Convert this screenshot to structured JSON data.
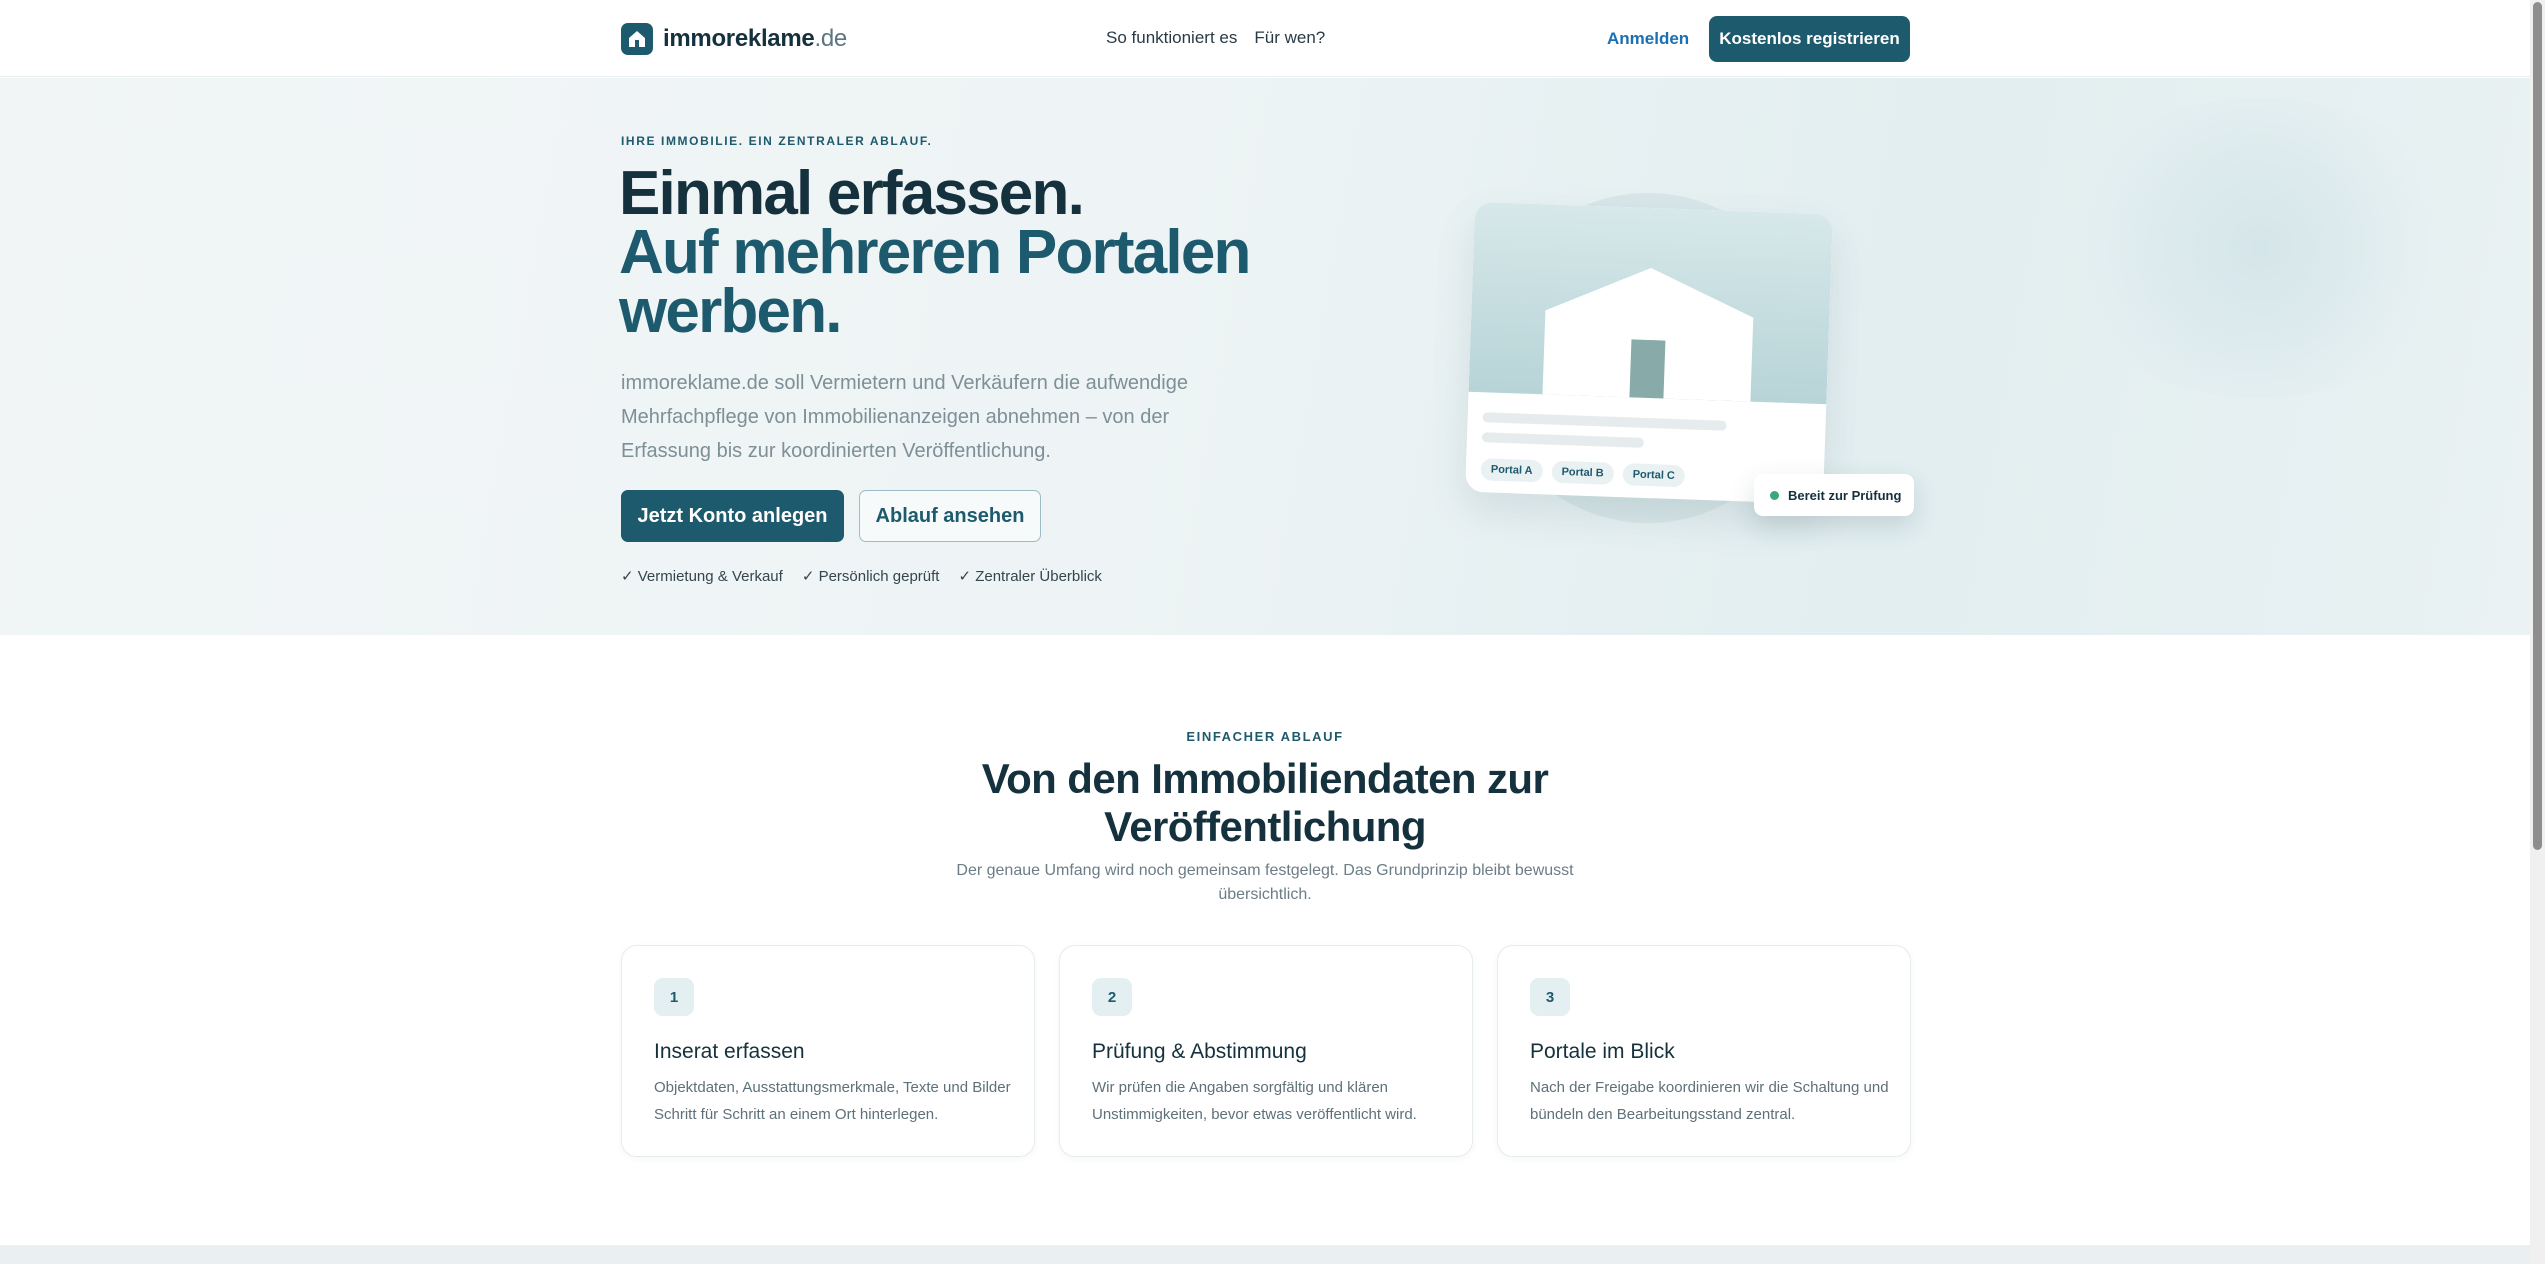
{
  "header": {
    "logo_main": "immoreklame",
    "logo_tld": ".de",
    "nav": [
      "So funktioniert es",
      "Für wen?"
    ],
    "login": "Anmelden",
    "register": "Kostenlos registrieren"
  },
  "hero": {
    "eyebrow": "IHRE IMMOBILIE. EIN ZENTRALER ABLAUF.",
    "title_line1": "Einmal erfassen.",
    "title_line2": "Auf mehreren Portalen werben.",
    "lead": "immoreklame.de soll Vermietern und Verkäufern die aufwendige Mehrfachpflege von Immobilienanzeigen abnehmen – von der Erfassung bis zur koordinierten Veröffentlichung.",
    "cta_primary": "Jetzt Konto anlegen",
    "cta_secondary": "Ablauf ansehen",
    "checks": [
      "✓ Vermietung & Verkauf",
      "✓ Persönlich geprüft",
      "✓ Zentraler Überblick"
    ],
    "illustration": {
      "portals": [
        "Portal A",
        "Portal B",
        "Portal C"
      ],
      "status": "Bereit zur Prüfung",
      "status_color": "#3aa87a"
    }
  },
  "process": {
    "eyebrow": "EINFACHER ABLAUF",
    "title": "Von den Immobiliendaten zur Veröffentlichung",
    "subtitle": "Der genaue Umfang wird noch gemeinsam festgelegt. Das Grundprinzip bleibt bewusst übersichtlich.",
    "steps": [
      {
        "num": "1",
        "title": "Inserat erfassen",
        "desc": "Objektdaten, Ausstattungsmerkmale, Texte und Bilder Schritt für Schritt an einem Ort hinterlegen."
      },
      {
        "num": "2",
        "title": "Prüfung & Abstimmung",
        "desc": "Wir prüfen die Angaben sorgfältig und klären Unstimmigkeiten, bevor etwas veröffentlicht wird."
      },
      {
        "num": "3",
        "title": "Portale im Blick",
        "desc": "Nach der Freigabe koordinieren wir die Schaltung und bündeln den Bearbeitungsstand zentral."
      }
    ]
  },
  "colors": {
    "brand": "#1e5a6e",
    "heading": "#14313d",
    "link": "#1b6fb3"
  }
}
